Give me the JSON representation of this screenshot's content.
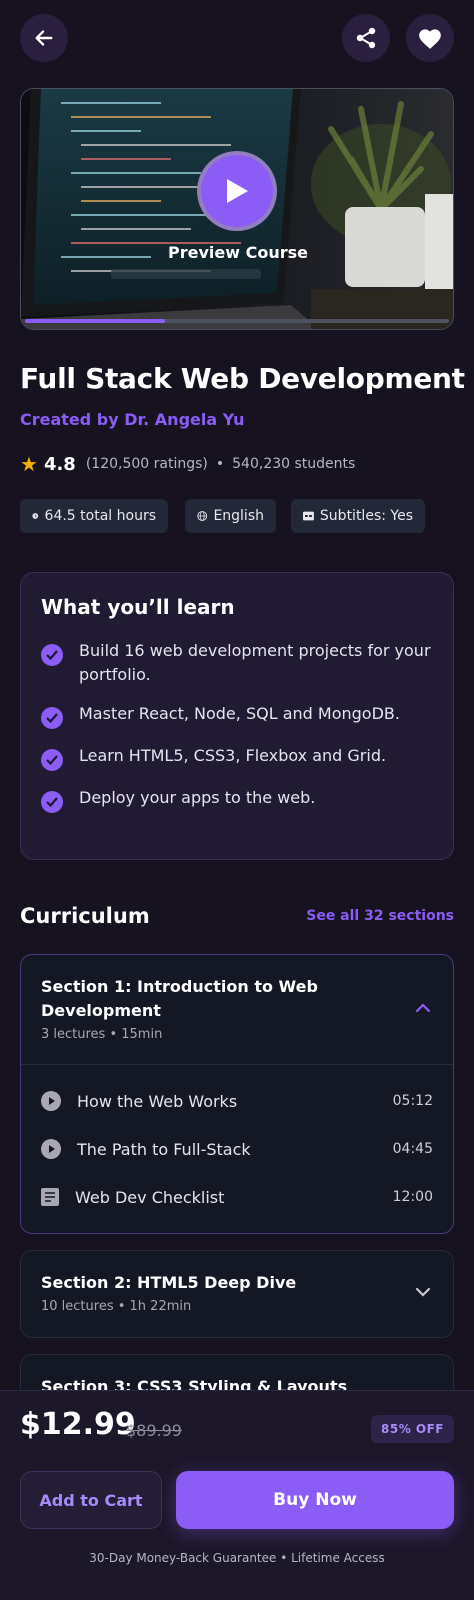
{
  "colors": {
    "accent": "#8b5cf6",
    "background": "#16121f",
    "star": "#f5b301"
  },
  "preview": {
    "label": "Preview Course",
    "progress_fraction": 0.33
  },
  "course": {
    "title": "Full Stack Web Development",
    "creator": "Created by Dr. Angela Yu",
    "rating": "4.8",
    "ratings_count": "(120,500 ratings)",
    "students": "540,230 students"
  },
  "tags": {
    "hours": "64.5 total hours",
    "language": "English",
    "subtitles": "Subtitles: Yes"
  },
  "learn": {
    "title": "What you’ll learn",
    "items": [
      "Build 16 web development projects for your portfolio.",
      "Master React, Node, SQL and MongoDB.",
      "Learn HTML5, CSS3, Flexbox and Grid.",
      "Deploy your apps to the web."
    ]
  },
  "curriculum": {
    "title": "Curriculum",
    "see_all": "See all 32 sections",
    "sections": [
      {
        "title": "Section 1: Introduction to Web Development",
        "meta": "3 lectures • 15min",
        "lectures": [
          {
            "name": "How the Web Works",
            "duration": "05:12",
            "icon": "play-circle-icon"
          },
          {
            "name": "The Path to Full-Stack",
            "duration": "04:45",
            "icon": "play-circle-icon"
          },
          {
            "name": "Web Dev Checklist",
            "duration": "12:00",
            "icon": "article-icon"
          }
        ]
      },
      {
        "title": "Section 2: HTML5 Deep Dive",
        "meta": "10 lectures • 1h 22min"
      },
      {
        "title": "Section 3: CSS3 Styling & Layouts"
      }
    ]
  },
  "purchase": {
    "price": "$12.99",
    "old_price": "$89.99",
    "discount": "85% OFF",
    "add_to_cart": "Add to Cart",
    "buy_now": "Buy Now",
    "guarantee": "30-Day Money-Back Guarantee • Lifetime Access"
  }
}
